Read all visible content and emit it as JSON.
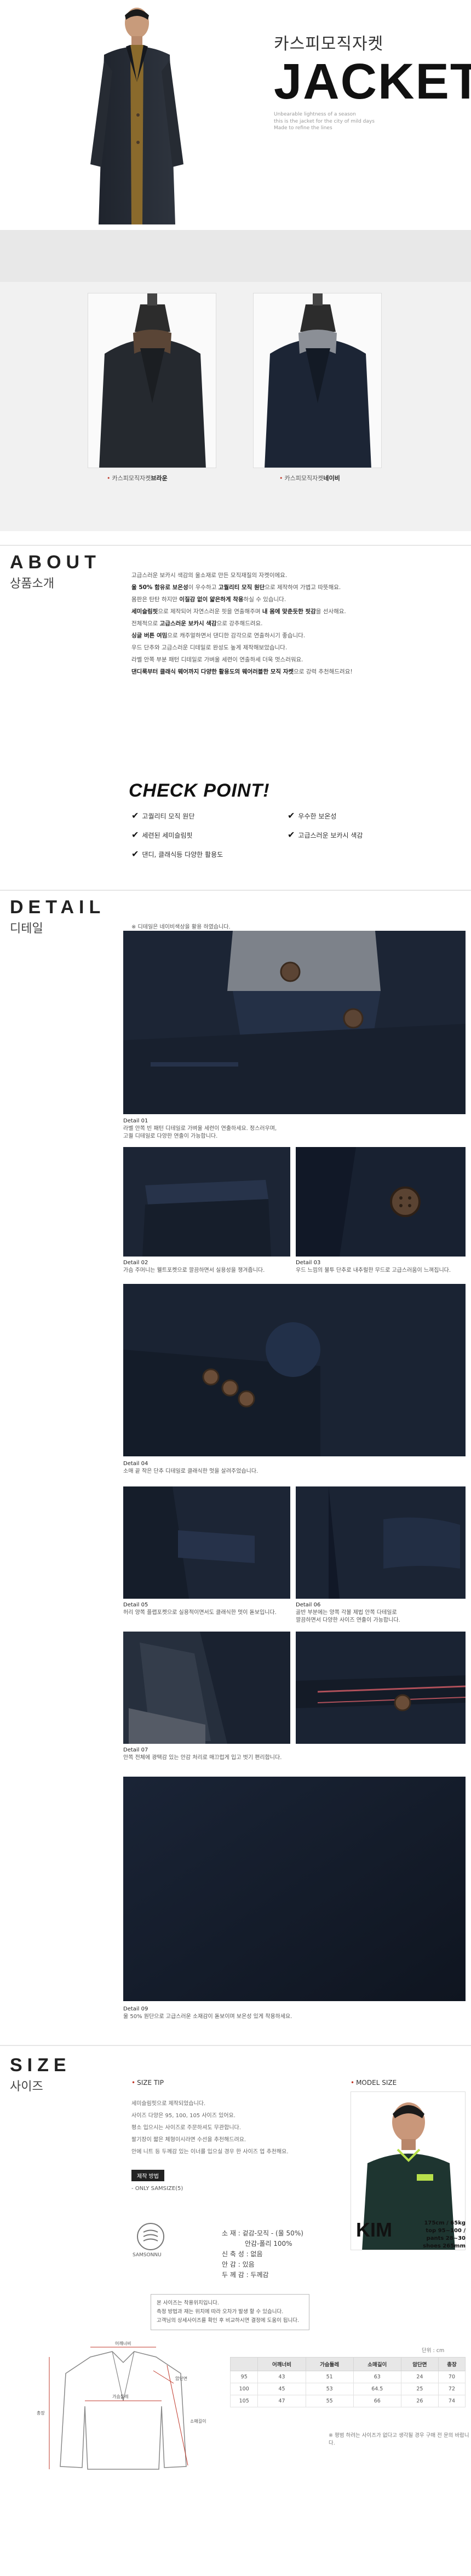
{
  "hero": {
    "title_ko": "카스피모직자켓",
    "title_en": "JACKET",
    "subtitle_lines": [
      "Unbearable lightness of a season",
      "this is the jacket for the city of mild days",
      "Made to refine the lines"
    ]
  },
  "colors": {
    "items": [
      {
        "label_prefix": "카스피모직자켓",
        "color_name": "브라운"
      },
      {
        "label_prefix": "카스피모직자켓",
        "color_name": "네이비"
      }
    ]
  },
  "about": {
    "heading_en": "ABOUT",
    "heading_ko": "상품소개",
    "lines": [
      {
        "parts": [
          {
            "t": "고급스러운 보카시 색감의 울소재로 만든 모직재질의 자켓이에요.",
            "b": false
          }
        ]
      },
      {
        "parts": [
          {
            "t": "울 50% 함유로 보온성",
            "b": true
          },
          {
            "t": "이 우수하고 ",
            "b": false
          },
          {
            "t": "고퀄리티 모직 원단",
            "b": true
          },
          {
            "t": "으로 제작하여 가볍고 따뜻해요.",
            "b": false
          }
        ]
      },
      {
        "parts": [
          {
            "t": "몸판은 탄탄 하지만 ",
            "b": false
          },
          {
            "t": "이질감 없이 얇은하게 착용",
            "b": true
          },
          {
            "t": "하실 수 있습니다.",
            "b": false
          }
        ]
      },
      {
        "parts": [
          {
            "t": "세미슬림핏",
            "b": true
          },
          {
            "t": "으로 제작되어 자연스러운 핏을 연출해주며 ",
            "b": false
          },
          {
            "t": "내 몸에 맞춘듯한 핏감",
            "b": true
          },
          {
            "t": "을 선사해요.",
            "b": false
          }
        ]
      },
      {
        "parts": [
          {
            "t": "전체적으로 ",
            "b": false
          },
          {
            "t": "고급스러운 보카시 색감",
            "b": true
          },
          {
            "t": "으로 강추해드려요.",
            "b": false
          }
        ]
      },
      {
        "parts": [
          {
            "t": "싱글 버튼 여밈",
            "b": true
          },
          {
            "t": "으로 캐주얼하면서 댄디한 감각으로 연출하시기 좋습니다.",
            "b": false
          }
        ]
      },
      {
        "parts": [
          {
            "t": "우드 단추와 고급스러운 디테일로 완성도 높게 제작해보았습니다.",
            "b": false
          }
        ]
      },
      {
        "parts": [
          {
            "t": "라벨 안쪽 부분 패턴 디테일로 가벼울 세련이 연출하세 더욱 멋스러워요.",
            "b": false
          }
        ]
      },
      {
        "parts": [
          {
            "t": "댄디룩부터 클래식 웨어까지 다양한 활용도의 웨어러블한 모직 자켓",
            "b": true
          },
          {
            "t": "으로 강력 추천해드려요!",
            "b": false
          }
        ]
      }
    ],
    "check_title": "CHECK POINT!",
    "check_points": [
      "고퀄리티 모직 원단",
      "우수한 보온성",
      "세련된 세미슬림핏",
      "고급스러운 보카시 색감",
      "댄디, 클래식등 다양한 활용도"
    ]
  },
  "detail": {
    "heading_en": "DETAIL",
    "heading_ko": "디테일",
    "note": "※ 디테일은 네이비색상을 활용 하였습니다.",
    "captions": [
      {
        "id": "Detail 01",
        "text": "라벨 안쪽 빈 패턴 디테일로 가벼울 세련이 연출하세요. 정스러우며,",
        "text2": "고퀄 디테일로 다양한 연출이 가능합니다."
      },
      {
        "id": "Detail 02",
        "text": "가슴 주머니는 웰트포켓으로 깔끔하면서 실용성을 챙겨줍니다.",
        "text2": ""
      },
      {
        "id": "Detail 03",
        "text": "우드 느낌의 불투 단추로 내추럴한 무드로 고급스러움이 느껴집니다.",
        "text2": ""
      },
      {
        "id": "Detail 04",
        "text": "소매 끝 작은 단추 디테일로 클래식한 멋을 살려주었습니다.",
        "text2": ""
      },
      {
        "id": "Detail 05",
        "text": "허리 양쪽 플랩포켓으로 실용적이면서도 클래식한 멋이 돋보입니다.",
        "text2": ""
      },
      {
        "id": "Detail 06",
        "text": "골반 부분에는 양쪽 각볼 제법 안쪽 다테일로",
        "text2": "깔끔하면서 다양한 사이즈 연출이 가능합니다."
      },
      {
        "id": "Detail 07",
        "text": "안쪽 전체에 광택감 있는 안감 처리로 매끄럽게 입고 벗기 편리합니다.",
        "text2": ""
      },
      {
        "id": "Detail 08",
        "text": "",
        "text2": ""
      },
      {
        "id": "Detail 09",
        "text": "울 50% 원단으로 고급스러운 소재감이 돋보이며 보온성 있게 착용하세요.",
        "text2": ""
      }
    ]
  },
  "size": {
    "heading_en": "SIZE",
    "heading_ko": "사이즈",
    "tip_title": "SIZE TIP",
    "tip_lines": [
      "세미슬림핏으로 제작되었습니다.",
      "사이즈 다양은 95, 100, 105 사이즈 있어요.",
      "평소 입으시는 사이즈로 주문하셔도 무관합니다.",
      "팔기장이 짧은 체형이시라면 수선을 추천해드려요.",
      "안에 니트 등 두께감 있는 이너를 입으실 경우 한 사이즈 업 추천해요."
    ],
    "fit_label": "제작 방법",
    "fit_value": "- ONLY SAMSIZE(5)",
    "fabric_icon_label": "SAMSONNU",
    "spec": [
      "소    재 : 겉감-모직 - (울 50%)",
      "           안감-폴리 100%",
      "신 축 성 : 없음",
      "안    감 : 있음",
      "두 께 감 : 두께감"
    ],
    "model_title": "MODEL SIZE",
    "model_name": "KIM",
    "model_lines": [
      "175cm / 65kg",
      "top 95~100 / pants 28~30",
      "shoes 265mm"
    ],
    "notice_lines": [
      "본 사이즈는 착용위치입니다.",
      "측정 방법과 재는 위치에 따라 오차가 발생 할 수 있습니다.",
      "고객님의 상세사이즈를 확인 후 비교하시면 결정에 도움이 됩니다."
    ],
    "unit": "단위 : cm",
    "table_headers": [
      "",
      "어깨너비",
      "가슴둘레",
      "소매길이",
      "암단면",
      "총장"
    ],
    "table_rows": [
      [
        "95",
        "43",
        "51",
        "63",
        "24",
        "70"
      ],
      [
        "100",
        "45",
        "53",
        "64.5",
        "25",
        "72"
      ],
      [
        "105",
        "47",
        "55",
        "66",
        "26",
        "74"
      ]
    ],
    "table_note": "※ 평범 하려는 사이즈가 없다고 생각될 경우 구매 전 문의 바랍니다.",
    "diagram_labels": [
      "어깨너비",
      "가슴둘레",
      "총장",
      "소매길이",
      "암단면"
    ]
  },
  "theme": {
    "fabric_navy": "#1d2738",
    "fabric_brown": "#3a2d25",
    "accent_red": "#c0392b"
  }
}
